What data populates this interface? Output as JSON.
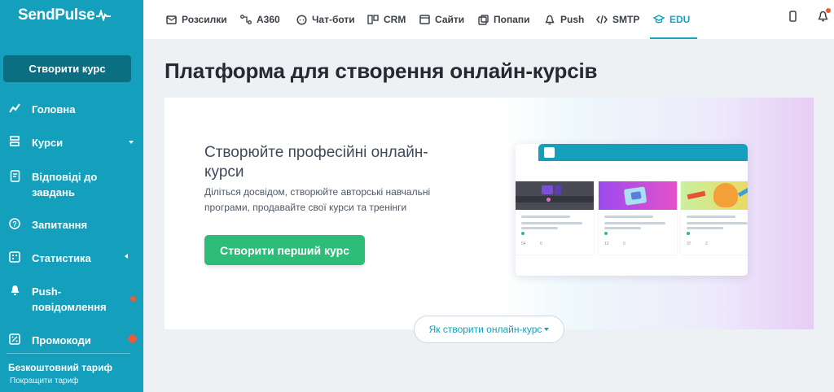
{
  "sidebar": {
    "logo": "SendPulse",
    "create_button": "Створити курс",
    "items": [
      {
        "label": "Головна",
        "icon": "chart-line-icon"
      },
      {
        "label": "Курси",
        "icon": "layers-icon"
      },
      {
        "label": "Відповіді до завдань",
        "icon": "document-check-icon"
      },
      {
        "label": "Запитання",
        "icon": "question-circle-icon"
      },
      {
        "label": "Статистика",
        "icon": "stats-grid-icon"
      },
      {
        "label": "Push-повідомлення",
        "icon": "push-icon"
      },
      {
        "label": "Промокоди",
        "icon": "discount-icon"
      }
    ],
    "plan_name": "Безкоштовний тариф",
    "plan_link": "Покращити тариф"
  },
  "topnav": {
    "items": [
      {
        "label": "Розсилки",
        "icon": "mail-icon"
      },
      {
        "label": "A360",
        "icon": "flow-icon"
      },
      {
        "label": "Чат-боти",
        "icon": "chat-icon"
      },
      {
        "label": "CRM",
        "icon": "crm-icon"
      },
      {
        "label": "Сайти",
        "icon": "site-icon"
      },
      {
        "label": "Попапи",
        "icon": "popup-icon"
      },
      {
        "label": "Push",
        "icon": "bell-icon"
      },
      {
        "label": "SMTP",
        "icon": "code-icon"
      },
      {
        "label": "EDU",
        "icon": "graduation-cap-icon"
      }
    ],
    "active": "EDU"
  },
  "main": {
    "title": "Платформа для створення онлайн-курсів",
    "card": {
      "heading": "Створюйте професійні онлайн-курси",
      "description": "Діліться досвідом, створюйте авторські навчальні програми, продавайте свої курси та тренінги",
      "button": "Створити перший курс"
    },
    "illustration": {
      "courses": [
        {
          "stat1": "54",
          "stat2": "0"
        },
        {
          "stat1": "12",
          "stat2": "0"
        },
        {
          "stat1": "37",
          "stat2": "2"
        }
      ]
    },
    "how_to": "Як створити онлайн-курс"
  },
  "colors": {
    "sidebar": "#14a0bd",
    "sidebar_button": "#0b6f84",
    "accent": "#1aa3c0",
    "primary_button": "#2ebd78",
    "badge": "#f05a3a"
  }
}
